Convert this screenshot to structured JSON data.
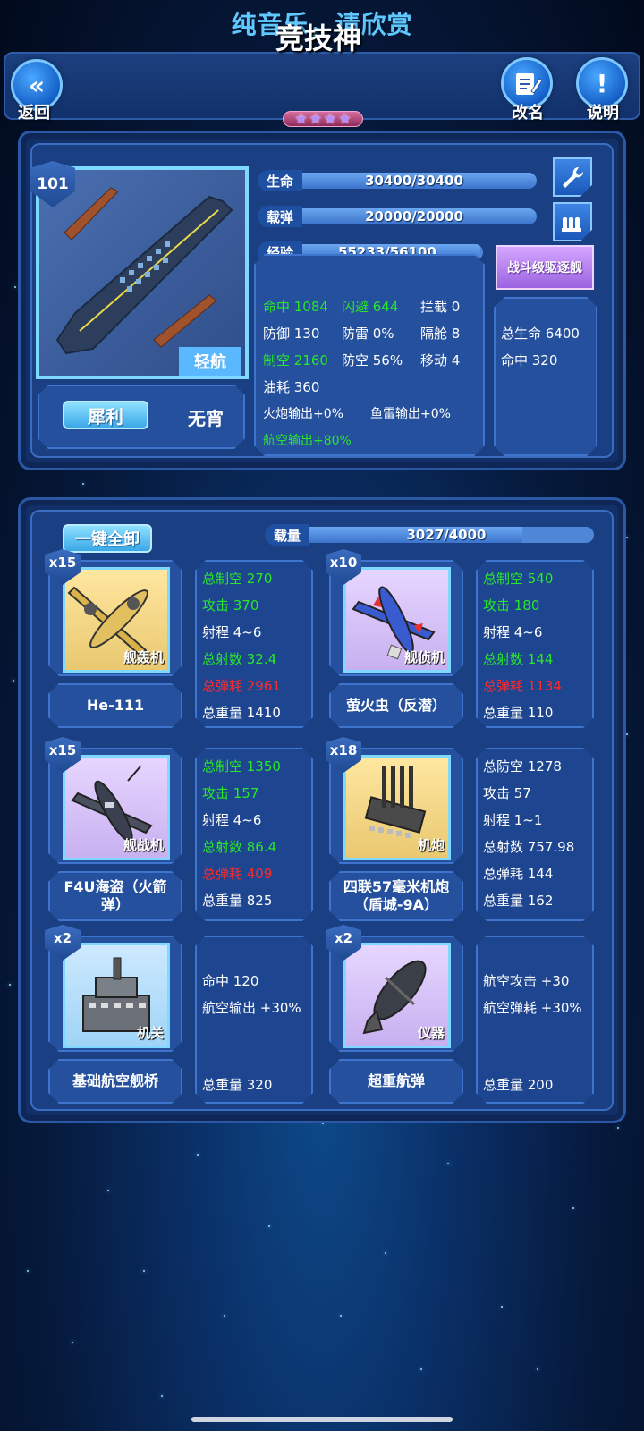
{
  "banner": "纯音乐，请欣赏",
  "header": {
    "title": "竞技神",
    "stars": [
      "★",
      "★",
      "★",
      "★"
    ],
    "back_label": "返回",
    "back_icon": "«",
    "rename_label": "改名",
    "info_label": "说明",
    "info_icon": "!"
  },
  "ship": {
    "level": "101",
    "type": "轻航",
    "name_button": "犀利",
    "title": "无宵",
    "bars": {
      "hp": {
        "label": "生命",
        "text": "30400/30400",
        "fraction": 1.0
      },
      "ammo": {
        "label": "载弹",
        "text": "20000/20000",
        "fraction": 1.0
      },
      "exp": {
        "label": "经验",
        "text": "55233/56100",
        "fraction": 0.985
      }
    },
    "stats": [
      {
        "text": "命中 1084",
        "color": "green"
      },
      {
        "text": "闪避 644",
        "color": "green"
      },
      {
        "text": "拦截 0",
        "color": "white"
      },
      {
        "text": "防御 130",
        "color": "white"
      },
      {
        "text": "防雷 0%",
        "color": "white"
      },
      {
        "text": "隔舱 8",
        "color": "white"
      },
      {
        "text": "制空 2160",
        "color": "green"
      },
      {
        "text": "防空 56%",
        "color": "white"
      },
      {
        "text": "移动 4",
        "color": "white"
      },
      {
        "text": "油耗 360",
        "color": "white"
      },
      {
        "text": "火炮输出+0%",
        "color": "white"
      },
      {
        "text": "鱼雷输出+0%",
        "color": "white"
      },
      {
        "text": "航空输出+80%",
        "color": "green"
      }
    ],
    "bonus": {
      "class_label": "战斗级驱逐舰",
      "lines": [
        "总生命 6400",
        "命中 320"
      ]
    }
  },
  "loadout": {
    "unload_all": "一键全卸",
    "capacity": {
      "label": "载量",
      "text": "3027/4000",
      "fraction": 0.757
    },
    "items": [
      {
        "count": "x15",
        "type": "舰轰机",
        "name": "He-111",
        "stats": [
          {
            "text": "总制空 270",
            "color": "green"
          },
          {
            "text": "攻击 370",
            "color": "green"
          },
          {
            "text": "射程 4~6",
            "color": "white"
          },
          {
            "text": "总射数 32.4",
            "color": "green"
          },
          {
            "text": "总弹耗 2961",
            "color": "red"
          },
          {
            "text": "总重量 1410",
            "color": "white"
          }
        ]
      },
      {
        "count": "x10",
        "type": "舰侦机",
        "name": "萤火虫（反潜）",
        "stats": [
          {
            "text": "总制空 540",
            "color": "green"
          },
          {
            "text": "攻击 180",
            "color": "green"
          },
          {
            "text": "射程 4~6",
            "color": "white"
          },
          {
            "text": "总射数 144",
            "color": "green"
          },
          {
            "text": "总弹耗 1134",
            "color": "red"
          },
          {
            "text": "总重量 110",
            "color": "white"
          }
        ]
      },
      {
        "count": "x15",
        "type": "舰战机",
        "name": "F4U海盗（火箭弹）",
        "stats": [
          {
            "text": "总制空 1350",
            "color": "green"
          },
          {
            "text": "攻击 157",
            "color": "green"
          },
          {
            "text": "射程 4~6",
            "color": "white"
          },
          {
            "text": "总射数 86.4",
            "color": "green"
          },
          {
            "text": "总弹耗 409",
            "color": "red"
          },
          {
            "text": "总重量 825",
            "color": "white"
          }
        ]
      },
      {
        "count": "x18",
        "type": "机炮",
        "name": "四联57毫米机炮（盾城-9A）",
        "stats": [
          {
            "text": "总防空 1278",
            "color": "white"
          },
          {
            "text": "攻击 57",
            "color": "white"
          },
          {
            "text": "射程 1~1",
            "color": "white"
          },
          {
            "text": "总射数 757.98",
            "color": "white"
          },
          {
            "text": "总弹耗 144",
            "color": "white"
          },
          {
            "text": "总重量 162",
            "color": "white"
          }
        ]
      },
      {
        "count": "x2",
        "type": "机关",
        "name": "基础航空舰桥",
        "stats": [
          {
            "text": "命中 120",
            "color": "white"
          },
          {
            "text": "航空输出 +30%",
            "color": "white"
          },
          {
            "text": "总重量 320",
            "color": "white"
          }
        ]
      },
      {
        "count": "x2",
        "type": "仪器",
        "name": "超重航弹",
        "stats": [
          {
            "text": "航空攻击 +30",
            "color": "white"
          },
          {
            "text": "航空弹耗 +30%",
            "color": "white"
          },
          {
            "text": "总重量 200",
            "color": "white"
          }
        ]
      }
    ]
  },
  "colors": {
    "accent": "#5ec8ff",
    "green": "#29e629",
    "red": "#ff2a2a",
    "panel": "#1a3f82"
  },
  "icons": {
    "back": "double-chevron-left-icon",
    "rename": "notepad-pencil-icon",
    "info": "exclamation-icon",
    "wrench": "wrench-icon",
    "ammo": "ammo-rack-icon"
  }
}
